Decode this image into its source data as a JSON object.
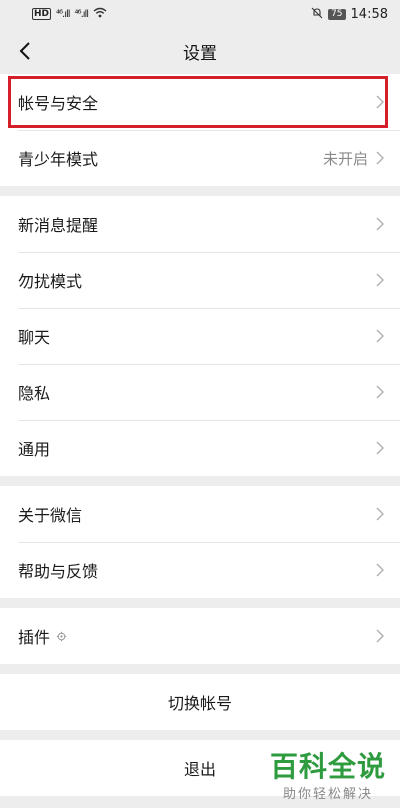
{
  "status_bar": {
    "network": "HD",
    "signal_1": "⁴⁶.ıll",
    "signal_2": "⁴⁶.ıll",
    "battery": "75",
    "time": "14:58"
  },
  "nav": {
    "title": "设置"
  },
  "groups": [
    {
      "rows": [
        {
          "label": "帐号与安全",
          "value": ""
        },
        {
          "label": "青少年模式",
          "value": "未开启"
        }
      ]
    },
    {
      "rows": [
        {
          "label": "新消息提醒",
          "value": ""
        },
        {
          "label": "勿扰模式",
          "value": ""
        },
        {
          "label": "聊天",
          "value": ""
        },
        {
          "label": "隐私",
          "value": ""
        },
        {
          "label": "通用",
          "value": ""
        }
      ]
    },
    {
      "rows": [
        {
          "label": "关于微信",
          "value": ""
        },
        {
          "label": "帮助与反馈",
          "value": ""
        }
      ]
    },
    {
      "rows": [
        {
          "label": "插件",
          "value": ""
        }
      ]
    }
  ],
  "switch_account_label": "切换帐号",
  "logout_label": "退出",
  "watermark": {
    "main": "百科全说",
    "sub": "助你轻松解决"
  },
  "colors": {
    "highlight": "#d41f2b",
    "watermark": "#2e9b3f",
    "background": "#ededed"
  },
  "icons": {
    "back": "chevron-left-icon",
    "row_arrow": "chevron-right-icon",
    "plugin_gear": "gear-icon",
    "mute": "bell-off-icon",
    "wifi": "wifi-icon"
  }
}
